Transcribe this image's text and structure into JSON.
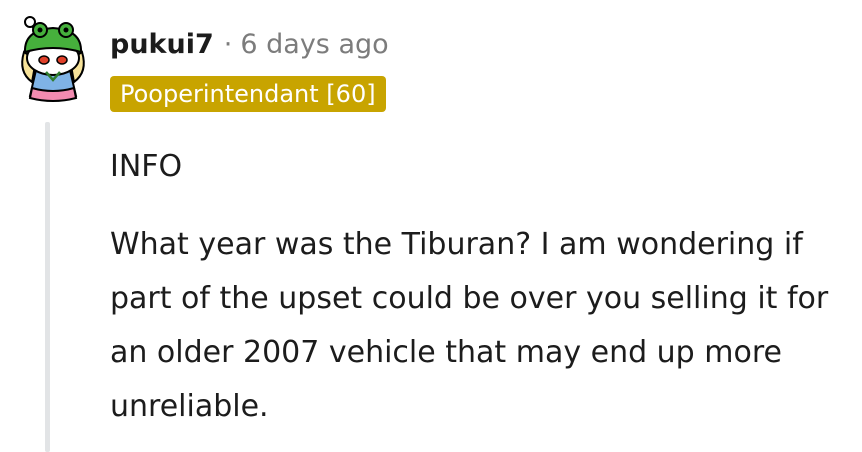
{
  "comment": {
    "username": "pukui7",
    "separator": "·",
    "timestamp": "6 days ago",
    "flair": "Pooperintendant [60]",
    "paragraphs": [
      "INFO",
      "What year was the Tiburan?  I am wondering if part of the upset could be over you selling it for an older 2007 vehicle that may end up more unreliable."
    ]
  },
  "colors": {
    "flair_bg": "#c8a400",
    "avatar_green": "#46b03c",
    "avatar_pink": "#f28bb0",
    "avatar_blue": "#7fb3e6",
    "thread_line": "#e2e4e6"
  },
  "icons": {
    "avatar": "snoo-frog-hat-avatar"
  }
}
